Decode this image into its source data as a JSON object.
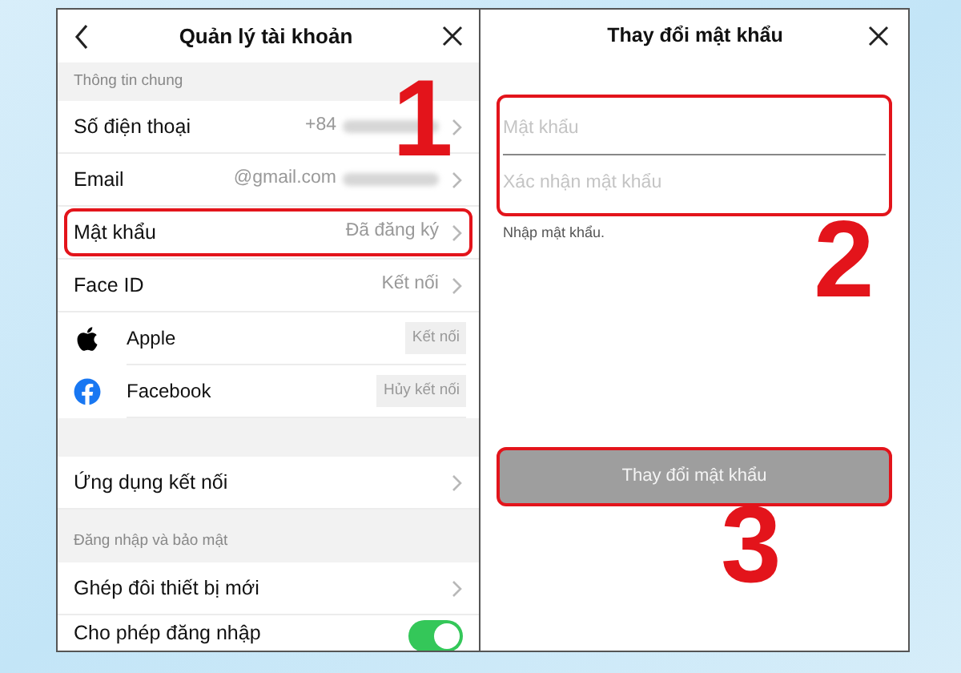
{
  "account_screen": {
    "title": "Quản lý tài khoản",
    "sections": [
      {
        "header": "Thông tin chung",
        "rows": [
          {
            "kind": "nav",
            "label": "Số điện thoại",
            "value": "+84",
            "redacted": true
          },
          {
            "kind": "nav",
            "label": "Email",
            "value": "@gmail.com",
            "redacted": true
          },
          {
            "kind": "nav",
            "label": "Mật khẩu",
            "value": "Đã đăng ký",
            "highlighted": true
          },
          {
            "kind": "nav",
            "label": "Face ID",
            "value": "Kết nối"
          },
          {
            "kind": "social",
            "label": "Apple",
            "button": "Kết nối"
          },
          {
            "kind": "social",
            "label": "Facebook",
            "button": "Hủy kết nối"
          }
        ]
      },
      {
        "rows": [
          {
            "kind": "nav",
            "label": "Ứng dụng kết nối"
          }
        ]
      },
      {
        "header": "Đăng nhập và bảo mật",
        "rows": [
          {
            "kind": "nav",
            "label": "Ghép đôi thiết bị mới"
          },
          {
            "kind": "toggle",
            "label": "Cho phép đăng nhập",
            "on": true
          }
        ]
      }
    ]
  },
  "password_screen": {
    "title": "Thay đổi mật khẩu",
    "fields": [
      {
        "placeholder": "Mật khẩu"
      },
      {
        "placeholder": "Xác nhận mật khẩu"
      }
    ],
    "fields_highlighted": true,
    "hint": "Nhập mật khẩu.",
    "button": {
      "label": "Thay đổi mật khẩu",
      "disabled": true,
      "highlighted": true
    }
  },
  "annotations": [
    {
      "label": "1"
    },
    {
      "label": "2"
    },
    {
      "label": "3"
    }
  ]
}
